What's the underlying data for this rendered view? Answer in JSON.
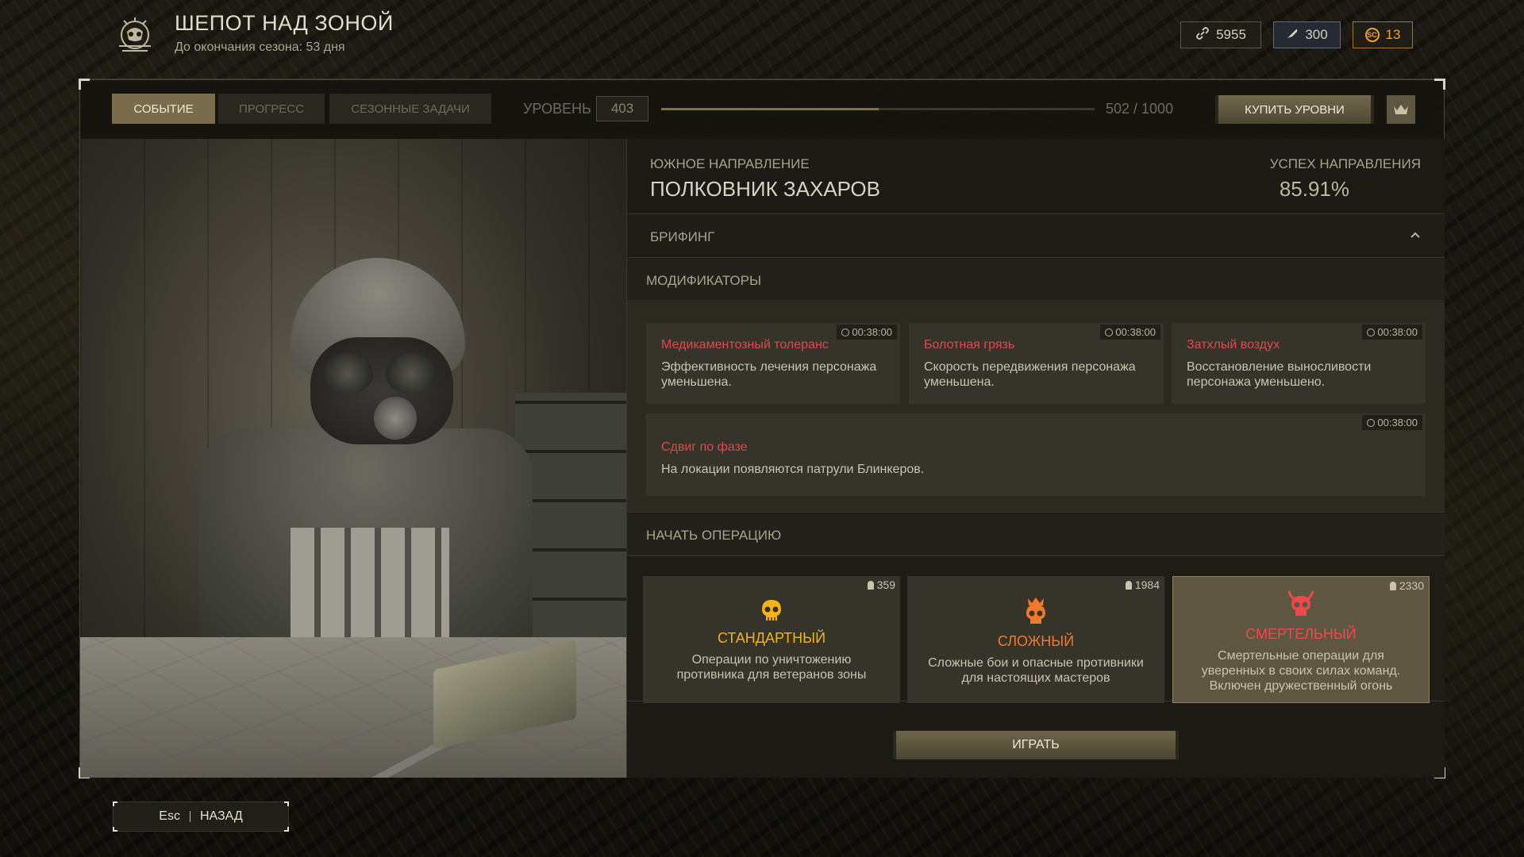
{
  "header": {
    "title": "ШЕПОТ НАД ЗОНОЙ",
    "subtitle": "До окончания сезона: 53 дня",
    "currencies": [
      {
        "icon": "link-icon",
        "value": "5955"
      },
      {
        "icon": "feather-icon",
        "value": "300"
      },
      {
        "icon": "coin-icon",
        "icon_text": "SC",
        "value": "13",
        "color": "#f0a52e"
      }
    ]
  },
  "toolbar": {
    "tabs": [
      {
        "label": "СОБЫТИЕ",
        "active": true
      },
      {
        "label": "ПРОГРЕСС",
        "active": false
      },
      {
        "label": "СЕЗОННЫЕ ЗАДАЧИ",
        "active": false
      }
    ],
    "level_label": "УРОВЕНЬ",
    "level_value": "403",
    "progress_text": "502 / 1000",
    "progress_fraction": 0.502,
    "buy_label": "КУПИТЬ УРОВНИ",
    "crown_icon": "crown-icon"
  },
  "direction": {
    "label": "ЮЖНОЕ НАПРАВЛЕНИЕ",
    "name": "ПОЛКОВНИК ЗАХАРОВ",
    "success_label": "УСПЕХ НАПРАВЛЕНИЯ",
    "success_value": "85.91%"
  },
  "briefing": {
    "label": "БРИФИНГ"
  },
  "modifiers": {
    "label": "МОДИФИКАТОРЫ",
    "items": [
      {
        "time": "00:38:00",
        "title": "Медикаментозный толеранс",
        "desc": "Эффективность лечения персонажа уменьшена."
      },
      {
        "time": "00:38:00",
        "title": "Болотная грязь",
        "desc": "Скорость передвижения персонажа уменьшена."
      },
      {
        "time": "00:38:00",
        "title": "Затхлый воздух",
        "desc": "Восстановление выносливости персонажа уменьшено."
      },
      {
        "time": "00:38:00",
        "title": "Сдвиг по фазе",
        "desc": "На локации появляются патрули Блинкеров."
      }
    ]
  },
  "operation": {
    "label": "НАЧАТЬ ОПЕРАЦИЮ",
    "modes": [
      {
        "count": "359",
        "title": "СТАНДАРТНЫЙ",
        "desc": "Операции по уничтожению противника для ветеранов зоны",
        "color": "#f2b416",
        "icon": "skull-icon"
      },
      {
        "count": "1984",
        "title": "СЛОЖНЫЙ",
        "desc": "Сложные бои и опасные противники для настоящих мастеров",
        "color": "#ef7a2a",
        "icon": "crowned-skull-icon"
      },
      {
        "count": "2330",
        "title": "СМЕРТЕЛЬНЫЙ",
        "desc": "Смертельные операции для уверенных в своих силах команд. Включен дружественный огонь",
        "color": "#ee4a4c",
        "icon": "demon-skull-icon",
        "selected": true
      }
    ],
    "play_label": "ИГРАТЬ"
  },
  "footer": {
    "back_key": "Esc",
    "back_label": "НАЗАД"
  }
}
